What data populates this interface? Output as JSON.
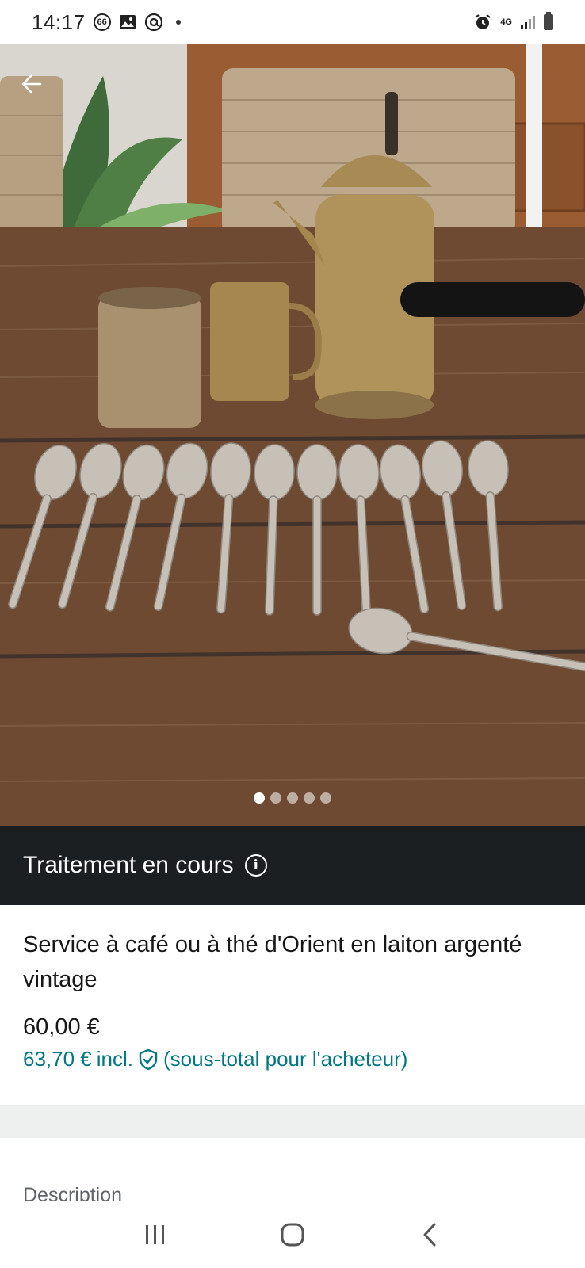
{
  "status_bar": {
    "time": "14:17",
    "badge_text": "66",
    "network": "4G",
    "icons": [
      "notification-count-icon",
      "gallery-icon",
      "at-sign-icon",
      "dot-icon",
      "alarm-icon",
      "network-4g-icon",
      "signal-icon",
      "battery-icon"
    ]
  },
  "photo": {
    "description_icons": [
      "back-arrow-icon"
    ],
    "carousel": {
      "total": 5,
      "active_index": 0
    }
  },
  "banner": {
    "text": "Traitement en cours",
    "icon": "info-icon",
    "background": "#1c1f22"
  },
  "item": {
    "title": "Service à café ou à thé d'Orient en laiton argenté vintage",
    "price": "60,00 €",
    "price_incl_amount": "63,70 €",
    "price_incl_label": "incl.",
    "price_incl_note": "(sous-total pour l'acheteur)",
    "accent_color": "#007782"
  },
  "description": {
    "label": "Description"
  },
  "nav_bar": {
    "icons": [
      "recent-apps-icon",
      "home-icon",
      "back-icon"
    ]
  }
}
